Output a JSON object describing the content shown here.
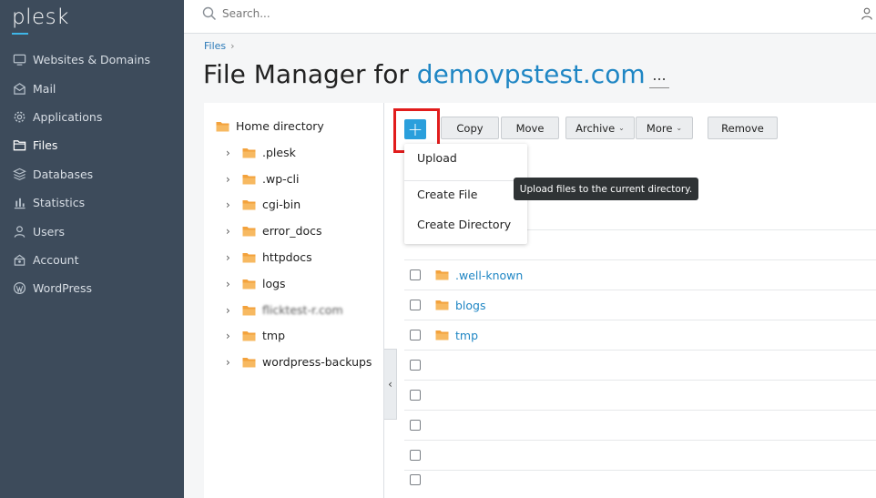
{
  "app": {
    "logo": "plesk"
  },
  "sidebar": {
    "items": [
      {
        "label": "Websites & Domains",
        "icon": "monitor-icon",
        "active": false
      },
      {
        "label": "Mail",
        "icon": "mail-icon",
        "active": false
      },
      {
        "label": "Applications",
        "icon": "gear-icon",
        "active": false
      },
      {
        "label": "Files",
        "icon": "files-icon",
        "active": true
      },
      {
        "label": "Databases",
        "icon": "database-icon",
        "active": false
      },
      {
        "label": "Statistics",
        "icon": "statistics-icon",
        "active": false
      },
      {
        "label": "Users",
        "icon": "user-icon",
        "active": false
      },
      {
        "label": "Account",
        "icon": "account-icon",
        "active": false
      },
      {
        "label": "WordPress",
        "icon": "wordpress-icon",
        "active": false
      }
    ],
    "collapse_glyph": "‹"
  },
  "search": {
    "placeholder": "Search..."
  },
  "breadcrumb": {
    "items": [
      "Files"
    ],
    "separator": "›"
  },
  "page": {
    "title_prefix": "File Manager for ",
    "domain": "demovpstest.com",
    "more_label": "..."
  },
  "tree": {
    "root": "Home directory",
    "items": [
      ".plesk",
      ".wp-cli",
      "cgi-bin",
      "error_docs",
      "httpdocs",
      "logs",
      "flicktest-r.com",
      "tmp",
      "wordpress-backups"
    ],
    "expand_glyph": "›",
    "collapse_glyph": "‹"
  },
  "toolbar": {
    "add_label": "+",
    "copy_label": "Copy",
    "move_label": "Move",
    "archive_label": "Archive",
    "more_label": "More",
    "remove_label": "Remove",
    "caret": "⌄"
  },
  "add_menu": {
    "items": [
      "Upload",
      "Create File",
      "Create Directory"
    ],
    "tooltip": "Upload files to the current directory."
  },
  "file_list": {
    "rows": [
      {
        "name": ".well-known",
        "type": "folder"
      },
      {
        "name": "blogs",
        "type": "folder"
      },
      {
        "name": "tmp",
        "type": "folder"
      },
      {
        "name": "",
        "type": "empty"
      },
      {
        "name": "",
        "type": "empty"
      },
      {
        "name": "",
        "type": "empty"
      },
      {
        "name": "",
        "type": "empty"
      },
      {
        "name": "",
        "type": "empty"
      }
    ]
  },
  "colors": {
    "sidebar_bg": "#3d4b5b",
    "accent": "#1f86c4",
    "add_button": "#2a9fdc",
    "highlight": "#e11c1c",
    "folder": "#f3a23c"
  }
}
